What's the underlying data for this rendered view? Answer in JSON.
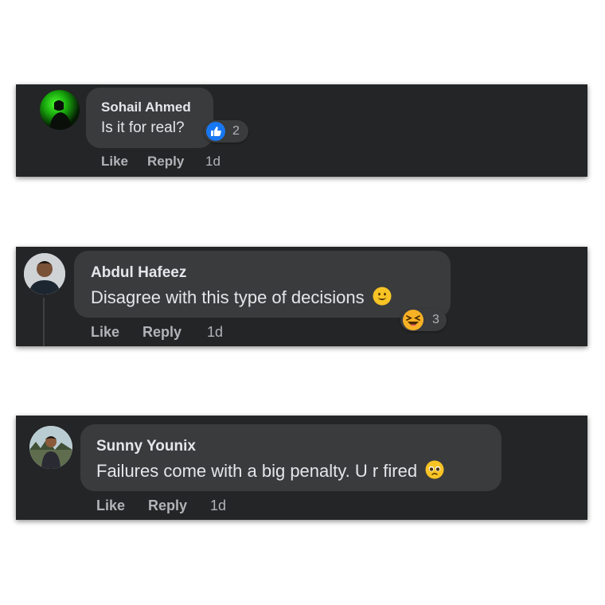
{
  "comments": [
    {
      "author": "Sohail Ahmed",
      "text": "Is it for real?",
      "reaction": {
        "icon": "like-icon",
        "count": "2",
        "color": "#1877f2"
      },
      "actions": {
        "like": "Like",
        "reply": "Reply",
        "time": "1d"
      }
    },
    {
      "author": "Abdul Hafeez",
      "text": "Disagree with this type of decisions",
      "inline_emoji": "smiling-face-icon",
      "reaction": {
        "icon": "haha-icon",
        "count": "3",
        "color": "#f7b125"
      },
      "actions": {
        "like": "Like",
        "reply": "Reply",
        "time": "1d"
      }
    },
    {
      "author": "Sunny Younix",
      "text": "Failures come with a big penalty. U r fired",
      "inline_emoji": "pleading-face-icon",
      "actions": {
        "like": "Like",
        "reply": "Reply",
        "time": "1d"
      }
    }
  ],
  "colors": {
    "card_bg": "#242526",
    "bubble_bg": "#3a3b3c",
    "primary_text": "#e4e6eb",
    "secondary_text": "#b0b3b8"
  }
}
